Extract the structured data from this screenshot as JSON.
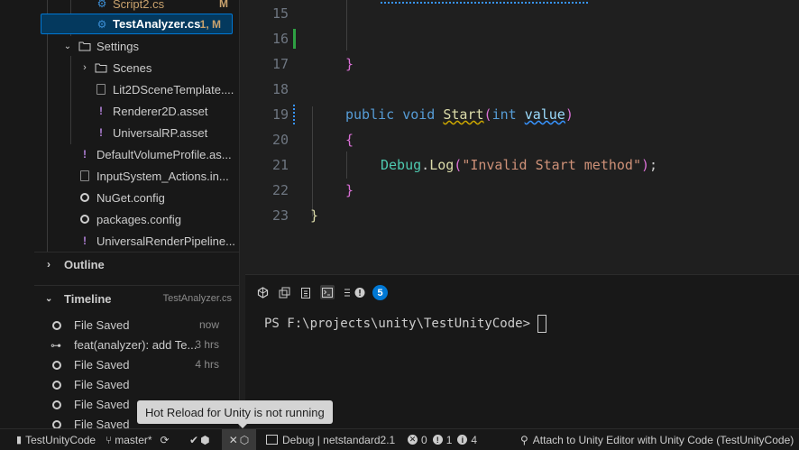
{
  "explorer": {
    "items": [
      {
        "label": "Script2.cs",
        "decoration": "M",
        "kind": "csharp"
      },
      {
        "label": "TestAnalyzer.cs",
        "decoration": "1, M",
        "kind": "csharp"
      },
      {
        "label": "Settings",
        "kind": "folder-open"
      },
      {
        "label": "Scenes",
        "kind": "folder-closed"
      },
      {
        "label": "Lit2DSceneTemplate....",
        "kind": "file"
      },
      {
        "label": "Renderer2D.asset",
        "kind": "asset"
      },
      {
        "label": "UniversalRP.asset",
        "kind": "asset"
      },
      {
        "label": "DefaultVolumeProfile.as...",
        "kind": "asset"
      },
      {
        "label": "InputSystem_Actions.in...",
        "kind": "file"
      },
      {
        "label": "NuGet.config",
        "kind": "config"
      },
      {
        "label": "packages.config",
        "kind": "config"
      },
      {
        "label": "UniversalRenderPipeline...",
        "kind": "asset"
      }
    ],
    "outline_label": "Outline",
    "timeline_label": "Timeline",
    "timeline_file": "TestAnalyzer.cs",
    "timeline": [
      {
        "text": "File Saved",
        "time": "now"
      },
      {
        "text": "feat(analyzer): add Te...",
        "time": "3 hrs"
      },
      {
        "text": "File Saved",
        "time": "4 hrs"
      },
      {
        "text": "File Saved",
        "time": ""
      },
      {
        "text": "File Saved",
        "time": ""
      },
      {
        "text": "File Saved",
        "time": ""
      }
    ]
  },
  "editor": {
    "lines": [
      {
        "num": "15"
      },
      {
        "num": "16"
      },
      {
        "num": "17"
      },
      {
        "num": "18"
      },
      {
        "num": "19"
      },
      {
        "num": "20"
      },
      {
        "num": "21"
      },
      {
        "num": "22"
      },
      {
        "num": "23"
      }
    ],
    "code": {
      "brace_close_inner": "}",
      "kw_public": "public",
      "kw_void": "void",
      "fn_start": "Start",
      "paren_open": "(",
      "kw_int": "int",
      "param_value": "value",
      "paren_close": ")",
      "brace_open": "{",
      "debug_cls": "Debug",
      "dot": ".",
      "log_fn": "Log",
      "str_msg": "\"Invalid Start method\"",
      "semicolon": ";",
      "brace_close": "}",
      "brace_close_outer": "}"
    }
  },
  "panel": {
    "badge_count": "5",
    "terminal_prompt": "PS F:\\projects\\unity\\TestUnityCode> "
  },
  "statusbar": {
    "project": "TestUnityCode",
    "branch": "master*",
    "config": "Debug | netstandard2.1",
    "errors": "0",
    "warnings": "1",
    "infos": "4",
    "attach": "Attach to Unity Editor with Unity Code (TestUnityCode)"
  },
  "tooltip": "Hot Reload for Unity is not running",
  "colors": {
    "accent": "#0078d4",
    "selection_bg": "#04395e",
    "modified_git": "#c9a26d",
    "added_gutter": "#2ea043",
    "badge": "#0078d4"
  }
}
